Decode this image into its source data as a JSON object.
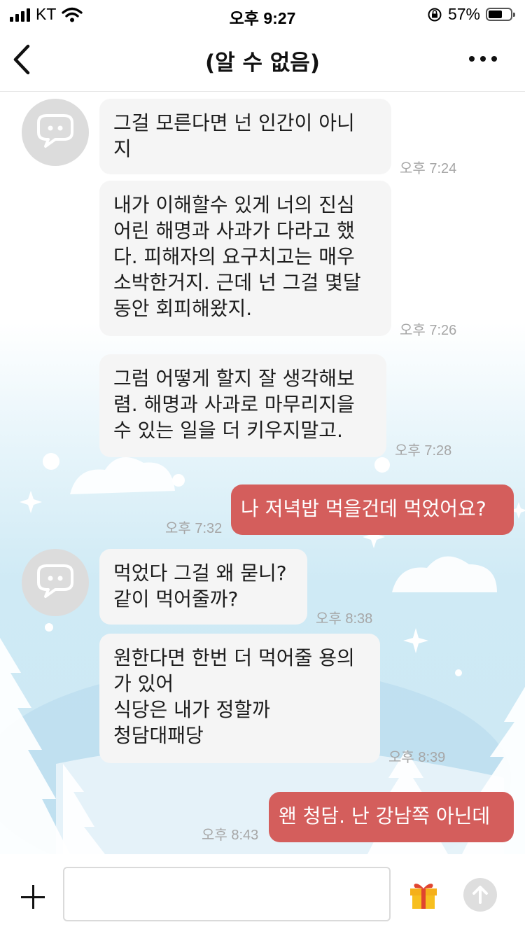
{
  "status_bar": {
    "carrier": "KT",
    "time": "오후 9:27",
    "battery": "57%"
  },
  "header": {
    "title": "(알 수 없음)"
  },
  "messages": [
    {
      "sender": "other",
      "text": "그걸 모른다면 넌 인간이 아니\n지",
      "time": "오후 7:24"
    },
    {
      "sender": "other",
      "text": "내가 이해할수 있게 너의 진심\n어린 해명과 사과가 다라고 했\n다. 피해자의 요구치고는 매우\n소박한거지. 근데 넌 그걸 몇달\n동안 회피해왔지.",
      "time": "오후 7:26"
    },
    {
      "sender": "other",
      "text": "그럼 어떻게 할지 잘 생각해보\n렴. 해명과 사과로 마무리지을\n수 있는 일을 더 키우지말고.",
      "time": "오후 7:28"
    },
    {
      "sender": "me",
      "text": "나 저녁밥 먹을건데 먹었어요?",
      "time": "오후 7:32"
    },
    {
      "sender": "other",
      "text": "먹었다 그걸 왜 묻니?\n같이 먹어줄까?",
      "time": "오후 8:38"
    },
    {
      "sender": "other",
      "text": "원한다면 한번 더 먹어줄 용의\n가 있어\n식당은 내가 정할까\n청담대패당",
      "time": "오후 8:39"
    },
    {
      "sender": "me",
      "text": "왠 청담. 난 강남쪽 아닌데",
      "time": "오후 8:43"
    }
  ],
  "icons": {
    "back": "chevron-left-icon",
    "more": "more-dots-icon",
    "avatar": "chat-bubble-face-icon",
    "attach": "plus-icon",
    "gift": "gift-icon",
    "send": "arrow-up-icon"
  },
  "colors": {
    "my_bubble": "#d45e5c",
    "other_bubble": "#f5f5f5",
    "gift": "#f5b01a",
    "gift_ribbon": "#e0452f"
  }
}
